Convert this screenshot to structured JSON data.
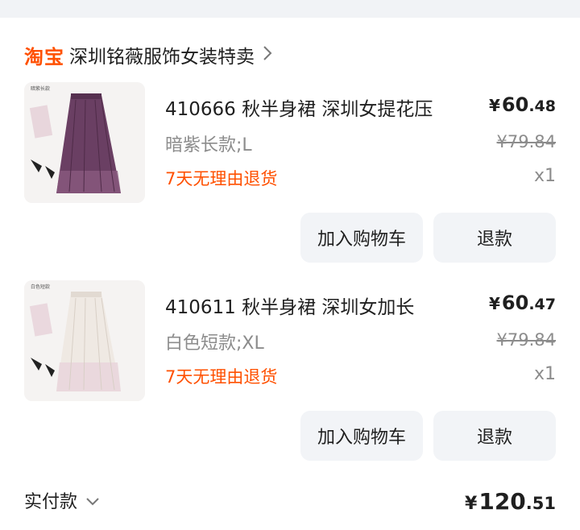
{
  "shop": {
    "logo": "淘宝",
    "name": "深圳铭薇服饰女装特卖"
  },
  "items": [
    {
      "thumb_caption": "暗紫长款",
      "title": "410666 秋半身裙 深圳女提花压",
      "variant": "暗紫长款;L",
      "policy": "7天无理由退货",
      "price_currency": "¥",
      "price_int": "60",
      "price_dec": ".48",
      "original_price": "¥79.84",
      "quantity": "x1",
      "add_to_cart_label": "加入购物车",
      "refund_label": "退款",
      "skirt_color": "#6a3f63"
    },
    {
      "thumb_caption": "白色短款",
      "title": "410611 秋半身裙 深圳女加长",
      "variant": "白色短款;XL",
      "policy": "7天无理由退货",
      "price_currency": "¥",
      "price_int": "60",
      "price_dec": ".47",
      "original_price": "¥79.84",
      "quantity": "x1",
      "add_to_cart_label": "加入购物车",
      "refund_label": "退款",
      "skirt_color": "#f1ece6"
    }
  ],
  "footer": {
    "label": "实付款",
    "total_currency": "¥",
    "total_int": "120",
    "total_dec": ".51"
  },
  "colors": {
    "accent": "#ff5000",
    "button_bg": "#f2f4f7",
    "muted_text": "#8c8c8c"
  }
}
